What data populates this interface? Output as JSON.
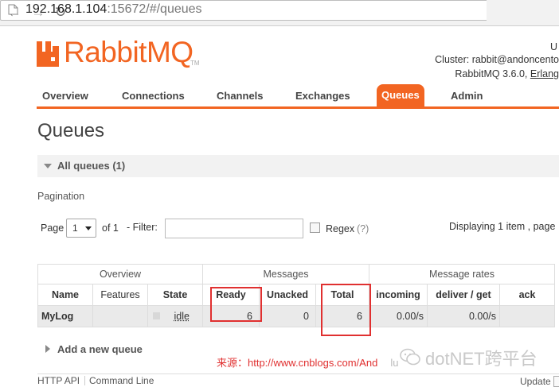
{
  "browser": {
    "url_host": "192.168.1.104",
    "url_rest": ":15672/#/queues"
  },
  "header": {
    "logo_text": "RabbitMQ",
    "logo_tm": "TM",
    "user_partial": "U",
    "cluster": "Cluster: rabbit@andoncento",
    "version": "RabbitMQ 3.6.0,",
    "erlang": "Erlang"
  },
  "tabs": [
    {
      "label": "Overview"
    },
    {
      "label": "Connections"
    },
    {
      "label": "Channels"
    },
    {
      "label": "Exchanges"
    },
    {
      "label": "Queues"
    },
    {
      "label": "Admin"
    }
  ],
  "active_tab": "Queues",
  "page_title": "Queues",
  "section": {
    "label": "All queues (1)"
  },
  "pagination": {
    "label": "Pagination",
    "page_label": "Page",
    "page_value": "1",
    "of_label": "of 1",
    "filter_label": "- Filter:",
    "filter_value": "",
    "regex_label": "Regex",
    "regex_help": "(?)",
    "displaying": "Displaying 1 item , page"
  },
  "table": {
    "groups": [
      "Overview",
      "Messages",
      "Message rates"
    ],
    "columns": [
      "Name",
      "Features",
      "State",
      "Ready",
      "Unacked",
      "Total",
      "incoming",
      "deliver / get",
      "ack"
    ],
    "rows": [
      {
        "name": "MyLog",
        "features": "",
        "state": "idle",
        "ready": "6",
        "unacked": "0",
        "total": "6",
        "incoming": "0.00/s",
        "deliver_get": "0.00/s",
        "ack": ""
      }
    ]
  },
  "add_queue": "Add a new queue",
  "watermark": {
    "source": "来源：http://www.cnblogs.com/And",
    "source_tail": "lu",
    "brand": "dotNET跨平台"
  },
  "footer": {
    "links": [
      "HTTP API",
      "Command Line"
    ],
    "update": "Update"
  },
  "colors": {
    "accent": "#f26522",
    "highlight_box": "#e03030"
  }
}
